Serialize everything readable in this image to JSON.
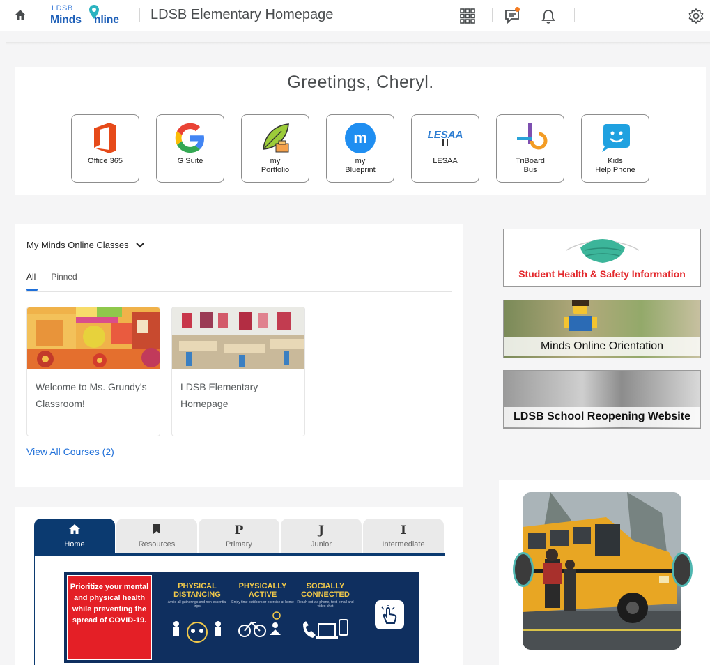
{
  "nav": {
    "logo_top": "LDSB",
    "logo_bottom_a": "Minds ",
    "logo_bottom_b": "nline",
    "org_title": "LDSB Elementary Homepage"
  },
  "greeting": "Greetings, Cheryl.",
  "apps": [
    {
      "label": "Office 365"
    },
    {
      "label": "G Suite"
    },
    {
      "label": "my\nPortfolio"
    },
    {
      "label": "my\nBlueprint"
    },
    {
      "label": "LESAA"
    },
    {
      "label": "TriBoard\nBus"
    },
    {
      "label": "Kids\nHelp Phone"
    }
  ],
  "app_icon_text": {
    "lesaa": "LESAA",
    "blueprint": "m"
  },
  "classes": {
    "header": "My Minds Online Classes",
    "tab_all": "All",
    "tab_pinned": "Pinned",
    "courses": [
      {
        "name": "Welcome to Ms. Grundy's Classroom!"
      },
      {
        "name": "LDSB Elementary Homepage"
      }
    ],
    "view_all": "View All Courses (2)"
  },
  "side_links": {
    "health": "Student Health & Safety Information",
    "orientation": "Minds Online Orientation",
    "reopening": "LDSB School Reopening Website"
  },
  "content_tabs": [
    {
      "glyph": "⌂",
      "label": "Home"
    },
    {
      "glyph": "▮",
      "label": "Resources"
    },
    {
      "glyph": "P",
      "label": "Primary"
    },
    {
      "glyph": "J",
      "label": "Junior"
    },
    {
      "glyph": "I",
      "label": "Intermediate"
    }
  ],
  "covid_banner": {
    "message": "Prioritize your mental and physical health while preventing the spread of COVID-19.",
    "col1": "PHYSICAL DISTANCING",
    "col1_sub": "Avoid all gatherings and non-essential trips",
    "col2": "PHYSICALLY ACTIVE",
    "col2_sub": "Enjoy time outdoors or exercise at home",
    "col3": "SOCIALLY CONNECTED",
    "col3_sub": "Reach out via phone, text, email and video chat"
  },
  "colors": {
    "brand_blue": "#1e6fd9",
    "navy": "#0b3a70",
    "alert_red": "#e3272b",
    "notif_orange": "#f47b20"
  }
}
